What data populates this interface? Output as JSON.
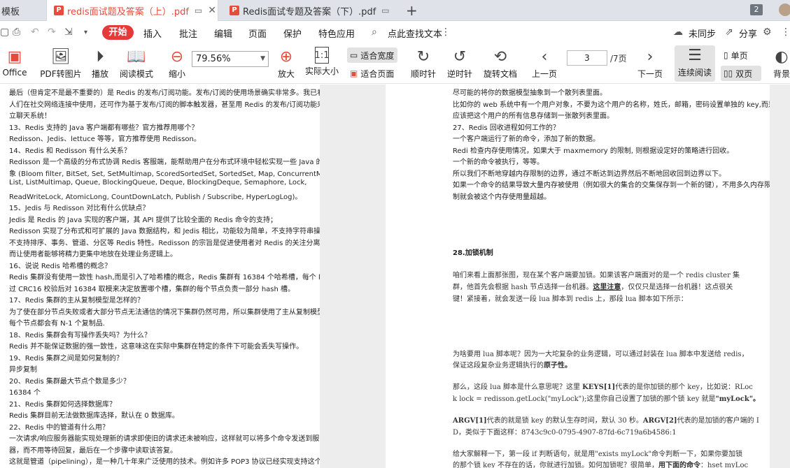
{
  "tabs": [
    {
      "label": "模板"
    },
    {
      "label": "redis面试题及答案（上）.pdf"
    },
    {
      "label": "Redis面试专题及答案（下）.pdf"
    }
  ],
  "tab_count": "2",
  "menu": {
    "start": "开始",
    "items": [
      "插入",
      "批注",
      "编辑",
      "页面",
      "保护",
      "特色应用"
    ],
    "search": "点此查找文本",
    "sync": "未同步",
    "share": "分享"
  },
  "toolbar": {
    "office": "Office",
    "pdf2img": "PDF转图片",
    "play": "播放",
    "read_mode": "阅读模式",
    "zoom_out": "缩小",
    "zoom_value": "79.56%",
    "zoom_in": "放大",
    "actual_size": "实际大小",
    "fit_width": "适合宽度",
    "fit_page": "适合页面",
    "rotate_cw": "顺时针",
    "rotate_ccw": "逆时针",
    "rotate_doc": "旋转文档",
    "prev_page": "上一页",
    "page_current": "3",
    "page_total": "/7页",
    "next_page": "下一页",
    "continuous": "连续阅读",
    "single": "单页",
    "double": "双页",
    "background": "背景"
  },
  "left_page": [
    "最后（但肯定不是最不重要的）是 Redis 的发布/订阅功能。发布/订阅的使用场景确实非常多。我已看见",
    "人们在社交网络连接中使用，还可作为基于发布/订阅的脚本触发器，甚至用 Redis 的发布/订阅功能来建",
    "立聊天系统！",
    "13、Redis 支持的 Java 客户端都有哪些？官方推荐用哪个？",
    "Redisson、Jedis、lettuce 等等，官方推荐使用 Redisson。",
    "14、Redis 和 Redisson 有什么关系？",
    "Redisson 是一个高级的分布式协调 Redis 客服端，能帮助用户在分布式环境中轻松实现一些 Java 的对",
    "象 (Bloom filter, BitSet, Set, SetMultimap, ScoredSortedSet, SortedSet, Map, ConcurrentMap,",
    "List, ListMultimap, Queue, BlockingQueue, Deque, BlockingDeque, Semaphore, Lock,",
    "ReadWriteLock, AtomicLong, CountDownLatch, Publish / Subscribe, HyperLogLog)。",
    "15、Jedis 与 Redisson 对比有什么优缺点？",
    "Jedis 是 Redis 的 Java 实现的客户端，其 API 提供了比较全面的 Redis 命令的支持；",
    "Redisson 实现了分布式和可扩展的 Java 数据结构，和 Jedis 相比，功能较为简单，不支持字符串操作，",
    "不支持排序、事务、管道、分区等 Redis 特性。Redisson 的宗旨是促进使用者对 Redis 的关注分离，从",
    "而让使用者能够将精力更集中地放在处理业务逻辑上。",
    "16、说说 Redis 哈希槽的概念？",
    "Redis 集群没有使用一致性 hash,而是引入了哈希槽的概念，Redis 集群有 16384 个哈希槽，每个 key 通",
    "过 CRC16 校验后对 16384 取模来决定放置哪个槽，集群的每个节点负责一部分 hash 槽。",
    "17、Redis 集群的主从复制模型是怎样的？",
    "为了使在部分节点失败或者大部分节点无法通信的情况下集群仍然可用，所以集群使用了主从复制模型,",
    "每个节点都会有 N-1 个复制品.",
    "18、Redis 集群会有写操作丢失吗？为什么？",
    "Redis 并不能保证数据的强一致性，这意味这在实际中集群在特定的条件下可能会丢失写操作。",
    "19、Redis 集群之间是如何复制的？",
    "异步复制",
    "20、Redis 集群最大节点个数是多少？",
    "16384 个",
    "21、Redis 集群如何选择数据库？",
    "Redis 集群目前无法做数据库选择，默认在 0 数据库。",
    "22、Redis 中的管道有什么用？",
    "一次请求/响应服务器能实现处理新的请求即使旧的请求还未被响应，这样就可以将多个命令发送到服务",
    "器，而不用等待回复，最后在一个步骤中读取该答复。",
    "这就是管道（pipelining），是一种几十年来广泛使用的技术。例如许多 POP3 协议已经实现支持这个功"
  ],
  "right_page_top": [
    "尽可能的将你的数据模型抽象到一个散列表里面。",
    "比如你的 web 系统中有一个用户对象，不要为这个用户的名称，姓氏，邮箱，密码设置单独的 key,而是",
    "应该把这个用户的所有信息存储到一张散列表里面。",
    "27、Redis 回收进程如何工作的？",
    "一个客户端运行了新的命令，添加了新的数据。",
    "Redi 检查内存使用情况，如果大于 maxmemory 的限制, 则根据设定好的策略进行回收。",
    "一个新的命令被执行，等等。",
    "所以我们不断地穿越内存限制的边界，通过不断达到边界然后不断地回收回到边界以下。",
    "如果一个命令的结果导致大量内存被使用（例如很大的集合的交集保存到一个新的键），不用多久内存限",
    "制就会被这个内存使用量超越。"
  ],
  "right_page_section": {
    "heading": "28.加锁机制",
    "p1_l1": "咱们来看上面那张图，现在某个客户端要加锁。如果该客户端面对的是一个 redis cluster 集",
    "p1_l2a": "群，他首先会根据 hash 节点选择一台机器。",
    "p1_l2b": "这里注意",
    "p1_l2c": "，仅仅只是选择一台机器！这点很关",
    "p1_l3": "键！紧接着，就会发送一段 lua 脚本到 redis 上，那段 lua 脚本如下所示：",
    "p2_l1": "为啥要用 lua 脚本呢？因为一大坨复杂的业务逻辑，可以通过封装在 lua 脚本中发送给 redis，",
    "p2_l2a": "保证这段复杂业务逻辑执行的",
    "p2_l2b": "原子性。",
    "p3_l1a": "那么，这段 lua 脚本是什么意思呢？这里 ",
    "p3_l1b": "KEYS[1]",
    "p3_l1c": "代表的是你加锁的那个 key，比如说：RLoc",
    "p3_l2a": "k lock = redisson.getLock(\"myLock\");这里你自己设置了加锁的那个锁 key 就是",
    "p3_l2b": "\"myLock\"。",
    "p4_l1a": "ARGV[1]",
    "p4_l1b": "代表的就是锁 key 的默认生存时间，默认 30 秒。",
    "p4_l1c": "ARGV[2]",
    "p4_l1d": "代表的是加锁的客户端的 I",
    "p4_l2": "D，类似于下面这样：8743c9c0-0795-4907-87fd-6c719a6b4586:1",
    "p5_l1": "给大家解释一下，第一段 if 判断语句，就是用\"exists myLock\"命令判断一下，如果你要加锁",
    "p5_l2a": "的那个锁 key 不存在的话，你就进行加锁。如何加锁呢？很简单，",
    "p5_l2b": "用下面的命令",
    "p5_l2c": "：hset myLoc"
  },
  "colors": {
    "accent": "#e6393a",
    "tab_bg": "#dfe3e9",
    "viewer_bg": "#ededed"
  }
}
